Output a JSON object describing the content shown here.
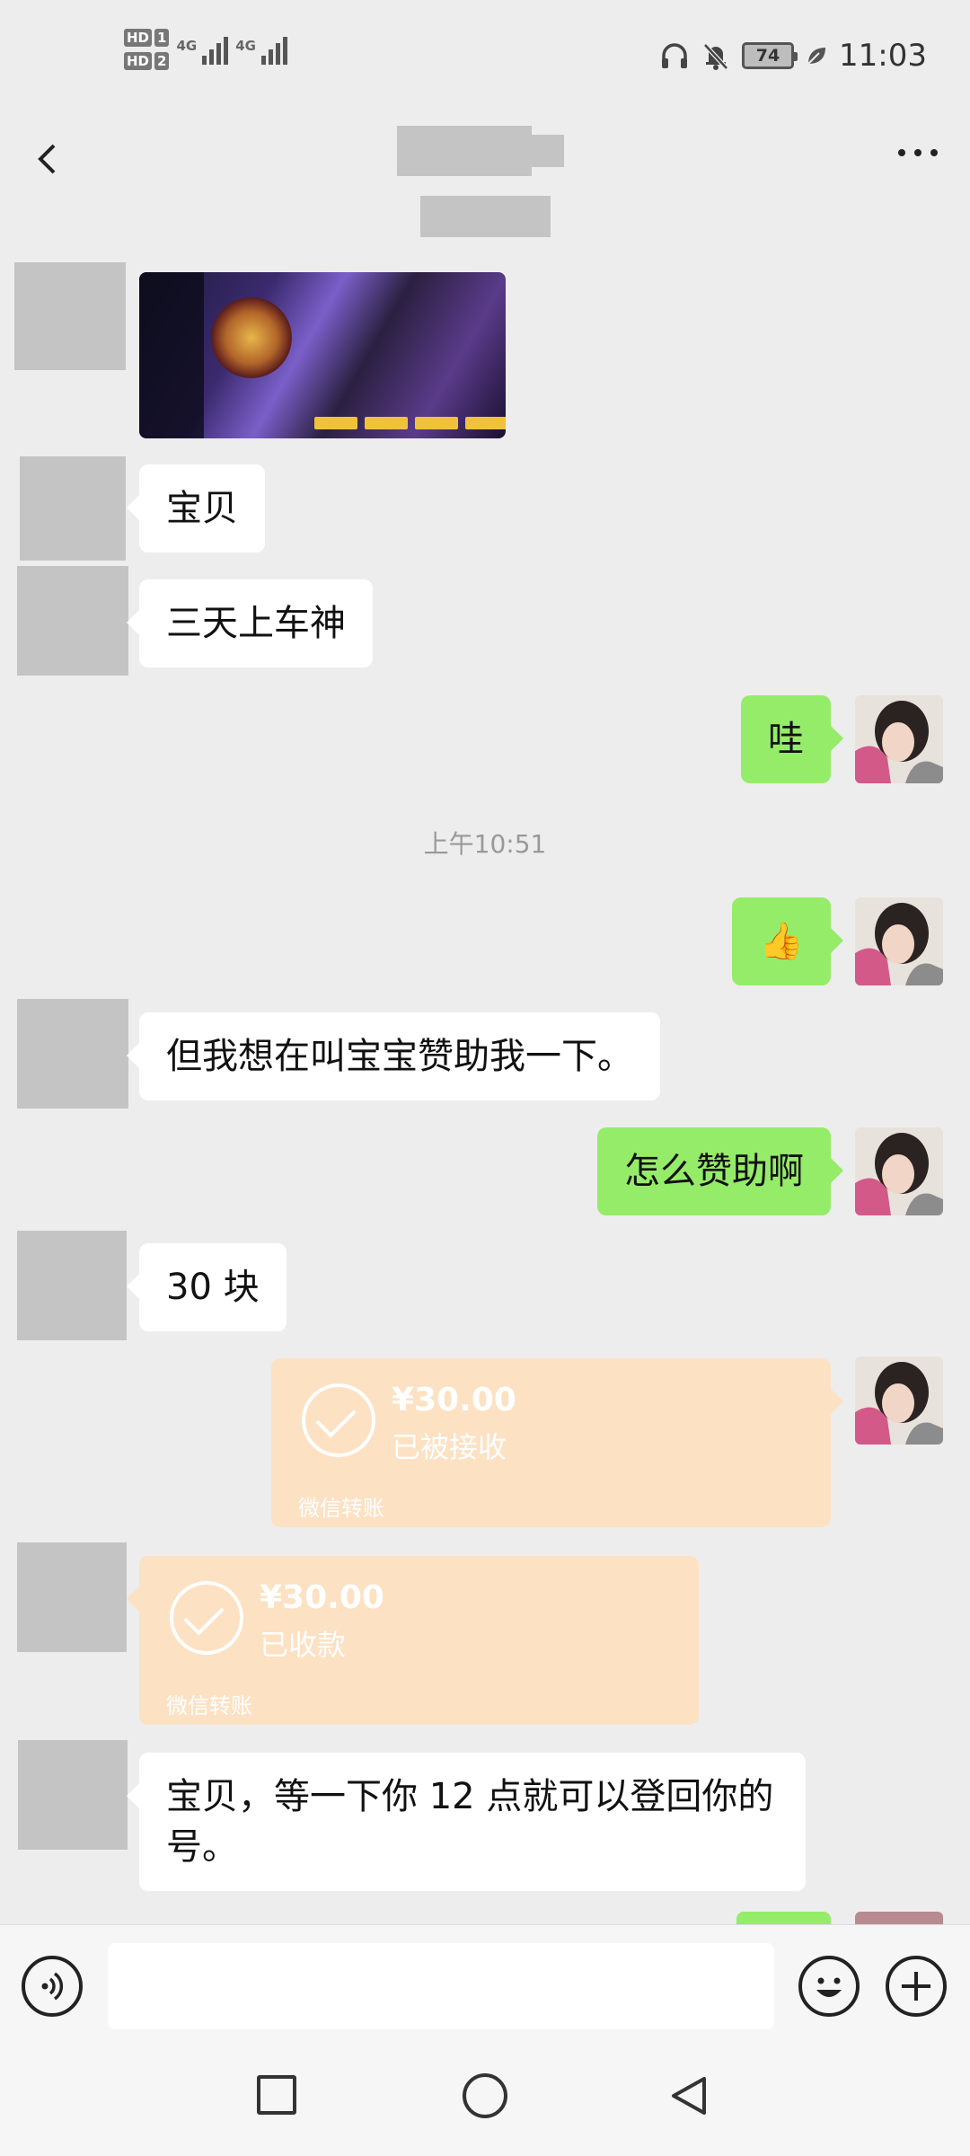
{
  "status_bar": {
    "sim1": "HD",
    "sim1_index": "1",
    "sim2": "HD",
    "sim2_index": "2",
    "net1": "4G",
    "net2": "4G",
    "battery": "74",
    "time": "11:03",
    "icons": [
      "headphones-icon",
      "bell-muted-icon",
      "leaf-icon"
    ]
  },
  "header": {
    "back_icon": "chevron-left-icon",
    "more_icon": "more-dots-icon"
  },
  "messages": [
    {
      "side": "in",
      "type": "image"
    },
    {
      "side": "in",
      "type": "text",
      "text": "宝贝"
    },
    {
      "side": "in",
      "type": "text",
      "text": "三天上车神"
    },
    {
      "side": "out",
      "type": "text",
      "text": "哇"
    },
    {
      "side": "out",
      "type": "emoji",
      "text": "👍"
    },
    {
      "side": "in",
      "type": "text",
      "text": "但我想在叫宝宝赞助我一下。"
    },
    {
      "side": "out",
      "type": "text",
      "text": "怎么赞助啊"
    },
    {
      "side": "in",
      "type": "text",
      "text": "30 块"
    },
    {
      "side": "out",
      "type": "transfer",
      "amount": "¥30.00",
      "status": "已被接收",
      "footer": "微信转账"
    },
    {
      "side": "in",
      "type": "transfer",
      "amount": "¥30.00",
      "status": "已收款",
      "footer": "微信转账"
    },
    {
      "side": "in",
      "type": "text",
      "text": "宝贝，等一下你 12 点就可以登回你的号。"
    }
  ],
  "timestamp": "上午10:51",
  "input_bar": {
    "voice_icon": "voice-icon",
    "emoji_icon": "emoji-icon",
    "plus_icon": "plus-icon",
    "placeholder": ""
  },
  "colors": {
    "background": "#ededed",
    "outgoing_bubble": "#95ec69",
    "incoming_bubble": "#ffffff",
    "transfer_card": "#fde1c3"
  }
}
